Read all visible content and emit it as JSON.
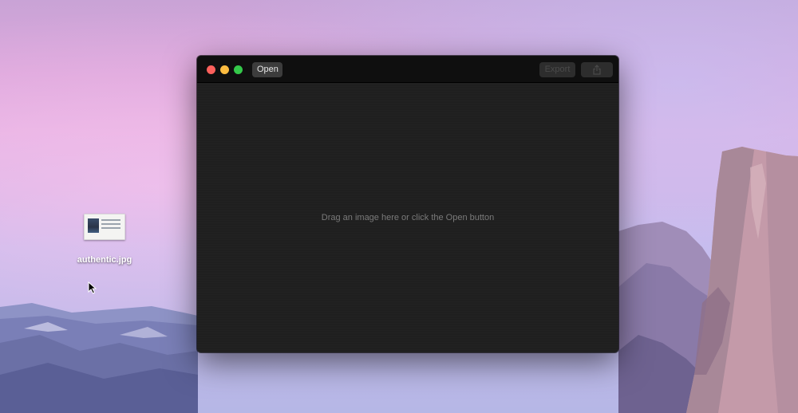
{
  "desktop": {
    "file": {
      "name": "authentic.jpg",
      "icon": "image-file-icon"
    }
  },
  "window": {
    "toolbar": {
      "open_label": "Open",
      "export_label": "Export",
      "share_icon": "share-icon"
    },
    "drop_hint": "Drag an image here or click the Open button",
    "colors": {
      "close": "#fc605c",
      "minimize": "#fdbc40",
      "maximize": "#34c84a"
    }
  }
}
